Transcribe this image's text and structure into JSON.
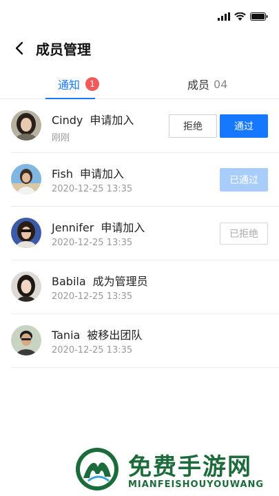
{
  "status_bar": {
    "signal_icon": "signal-icon",
    "wifi_icon": "wifi-icon",
    "battery_icon": "battery-icon"
  },
  "header": {
    "title": "成员管理",
    "back_icon": "chevron-left-icon"
  },
  "tabs": [
    {
      "label": "通知",
      "badge": "1",
      "active": true
    },
    {
      "label": "成员",
      "count": "04",
      "active": false
    }
  ],
  "notifications": [
    {
      "name": "Cindy",
      "action": "申请加入",
      "time": "刚刚",
      "reject_label": "拒绝",
      "approve_label": "通过"
    },
    {
      "name": "Fish",
      "action": "申请加入",
      "time": "2020-12-25   13:35",
      "status_label": "已通过"
    },
    {
      "name": "Jennifer",
      "action": "申请加入",
      "time": "2020-12-25   13:35",
      "status_label": "已拒绝"
    },
    {
      "name": "Babila",
      "action": "成为管理员",
      "time": "2020-12-25   13:35"
    },
    {
      "name": "Tania",
      "action": "被移出团队",
      "time": "2020-12-25   13:35"
    }
  ],
  "watermark": {
    "title": "免费手游网",
    "subtitle": "MIANFEISHOUYOUWANG"
  },
  "colors": {
    "accent": "#1677ff",
    "badge": "#f25a5a",
    "approved_bg": "#a8cdfb",
    "watermark": "#1c6b3a"
  }
}
